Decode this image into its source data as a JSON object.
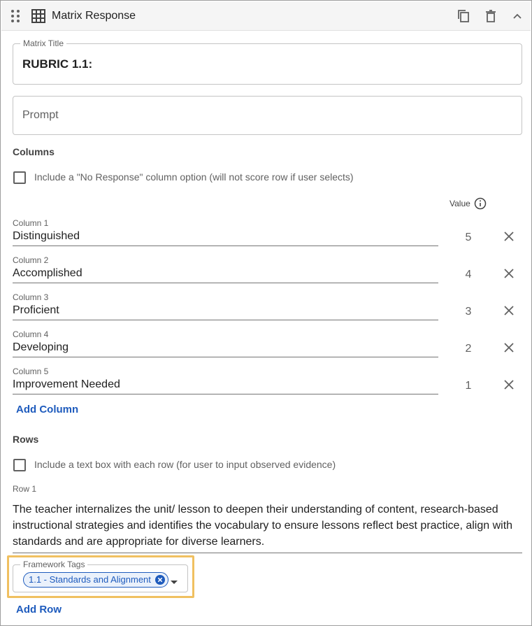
{
  "header": {
    "title": "Matrix Response",
    "icons": [
      "drag-handle-icon",
      "grid-icon",
      "copy-icon",
      "delete-icon",
      "chevron-up-icon"
    ]
  },
  "matrix_title": {
    "label": "Matrix Title",
    "value": "RUBRIC 1.1:"
  },
  "prompt": {
    "placeholder": "Prompt"
  },
  "columns": {
    "heading": "Columns",
    "no_response_label": "Include a \"No Response\" column option (will not score row if user selects)",
    "no_response_checked": false,
    "value_heading": "Value",
    "items": [
      {
        "label": "Column 1",
        "name": "Distinguished",
        "value": "5"
      },
      {
        "label": "Column 2",
        "name": "Accomplished",
        "value": "4"
      },
      {
        "label": "Column 3",
        "name": "Proficient",
        "value": "3"
      },
      {
        "label": "Column 4",
        "name": "Developing",
        "value": "2"
      },
      {
        "label": "Column 5",
        "name": "Improvement Needed",
        "value": "1"
      }
    ],
    "add_label": "Add Column"
  },
  "rows": {
    "heading": "Rows",
    "text_box_label": "Include a text box with each row (for user to input observed evidence)",
    "text_box_checked": false,
    "items": [
      {
        "label": "Row 1",
        "text": "The teacher internalizes the unit/ lesson to deepen their understanding of content, research-based instructional strategies and identifies the vocabulary to ensure lessons reflect best practice, align with standards and are appropriate for diverse learners."
      }
    ],
    "framework_tags": {
      "label": "Framework Tags",
      "chips": [
        "1.1 - Standards and Alignment"
      ]
    },
    "add_label": "Add Row"
  },
  "colors": {
    "accent": "#1e5bbd",
    "highlight": "#f0c060",
    "header_bg": "#f5f5f5"
  }
}
